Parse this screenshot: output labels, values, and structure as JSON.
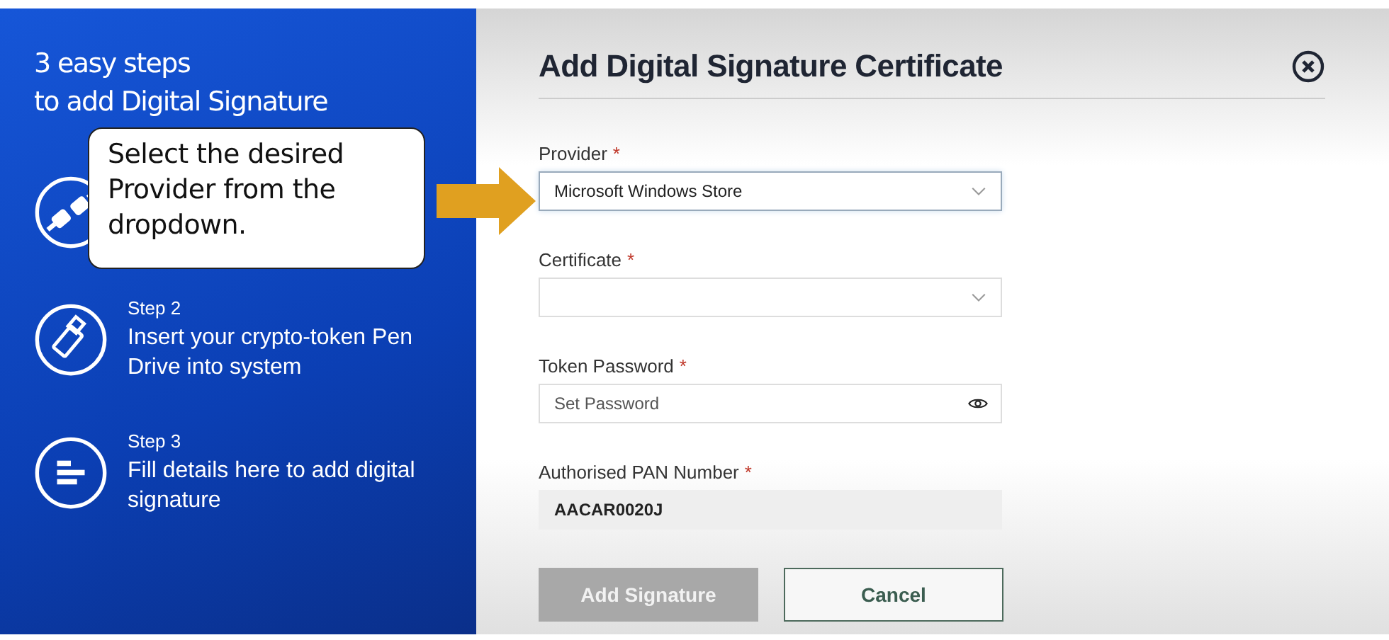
{
  "sidebar": {
    "title_lines": [
      "3 easy steps",
      "to add Digital Signature"
    ],
    "steps": [
      {
        "kind": "plug"
      },
      {
        "kind": "usb",
        "label": "Step 2",
        "text": "Insert your crypto-token Pen Drive into system"
      },
      {
        "kind": "form",
        "label": "Step 3",
        "text": "Fill details here to add digital signature"
      }
    ]
  },
  "callout": {
    "text": "Select the desired Provider from the dropdown."
  },
  "dialog": {
    "title": "Add Digital Signature Certificate",
    "fields": [
      {
        "kind": "select",
        "label": "Provider",
        "required_mark": "*",
        "value": "Microsoft Windows Store",
        "highlighted": true
      },
      {
        "kind": "select",
        "label": "Certificate",
        "required_mark": "*",
        "highlighted": false
      },
      {
        "kind": "password",
        "label": "Token Password",
        "required_mark": "*",
        "placeholder": "Set Password",
        "highlighted": false
      },
      {
        "kind": "readonly",
        "label": "Authorised PAN Number",
        "required_mark": "*",
        "value": "AACAR0020J",
        "highlighted": false
      }
    ],
    "buttons": [
      {
        "label": "Add Signature",
        "kind": "primary",
        "disabled": true
      },
      {
        "label": "Cancel",
        "kind": "secondary",
        "disabled": false
      }
    ]
  }
}
